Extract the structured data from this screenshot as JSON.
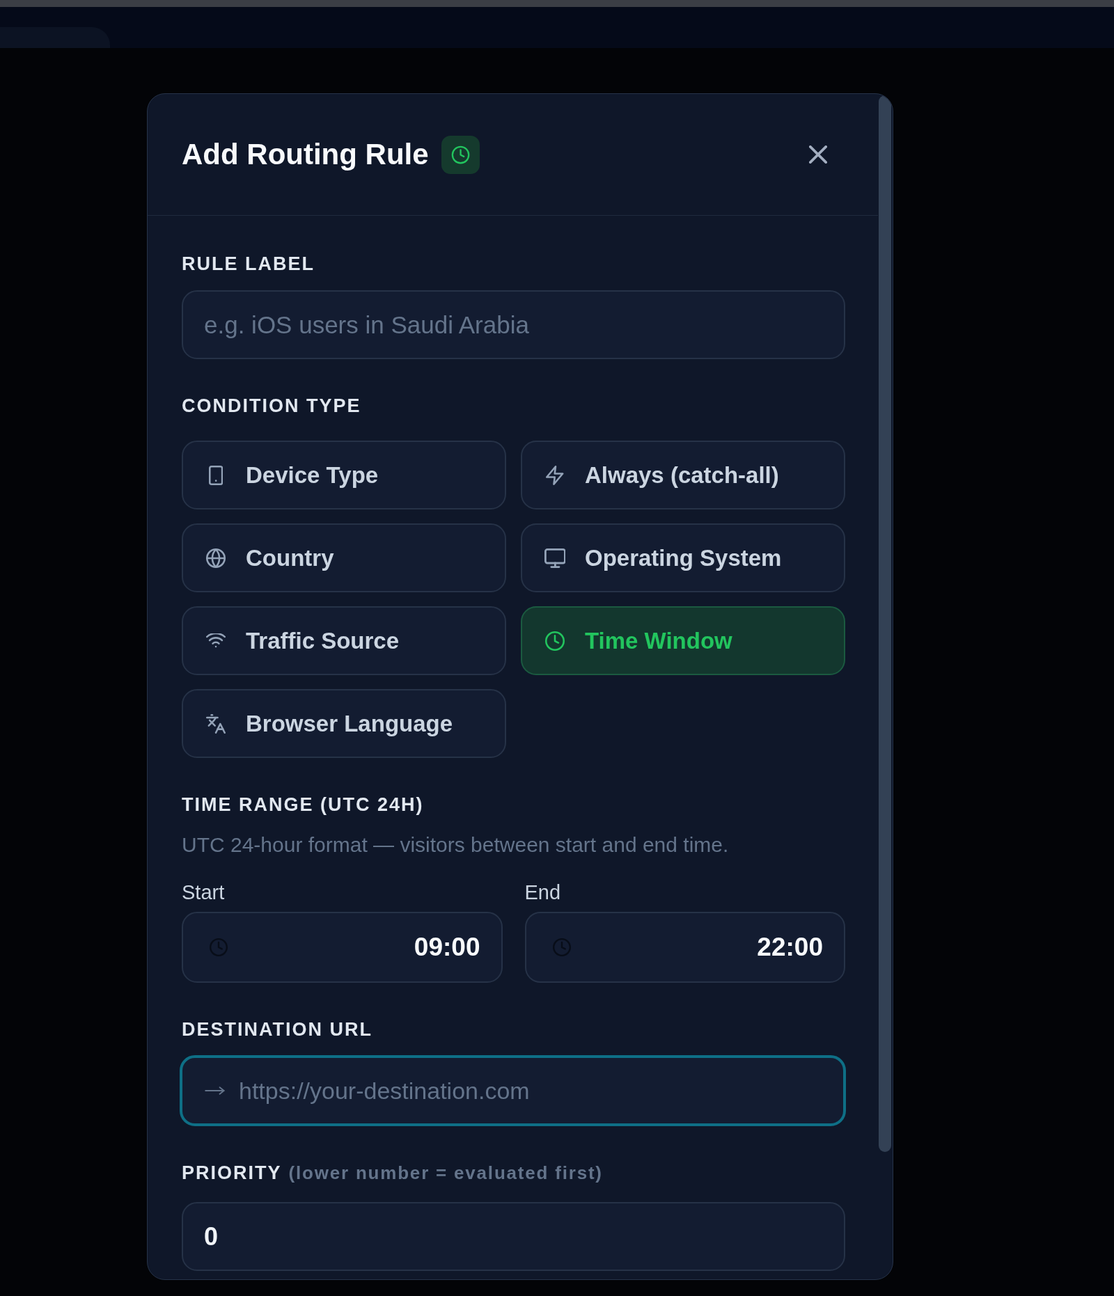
{
  "dialog": {
    "title": "Add Routing Rule"
  },
  "rule_label": {
    "label": "RULE LABEL",
    "placeholder": "e.g. iOS users in Saudi Arabia"
  },
  "condition_type": {
    "label": "CONDITION TYPE",
    "options": [
      {
        "kind": "device",
        "label": "Device Type",
        "selected": false
      },
      {
        "kind": "always",
        "label": "Always (catch-all)",
        "selected": false
      },
      {
        "kind": "country",
        "label": "Country",
        "selected": false
      },
      {
        "kind": "os",
        "label": "Operating System",
        "selected": false
      },
      {
        "kind": "traffic",
        "label": "Traffic Source",
        "selected": false
      },
      {
        "kind": "time",
        "label": "Time Window",
        "selected": true
      },
      {
        "kind": "language",
        "label": "Browser Language",
        "selected": false
      }
    ]
  },
  "time_range": {
    "label": "TIME RANGE (UTC 24H)",
    "hint": "UTC 24-hour format — visitors between start and end time.",
    "start": {
      "label": "Start",
      "value": "09:00"
    },
    "end": {
      "label": "End",
      "value": "22:00"
    }
  },
  "destination_url": {
    "label": "DESTINATION URL",
    "placeholder": "https://your-destination.com",
    "focused": true
  },
  "priority": {
    "label": "PRIORITY",
    "hint": "(lower number = evaluated first)",
    "value": "0"
  }
}
